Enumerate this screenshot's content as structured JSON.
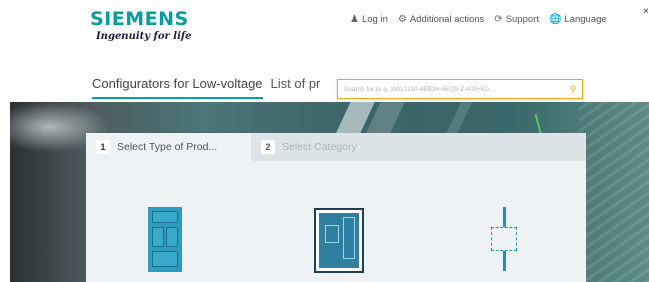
{
  "brand": {
    "name": "SIEMENS",
    "tagline": "Ingenuity for life"
  },
  "header_actions": [
    {
      "label": "Log in",
      "icon": "user-icon"
    },
    {
      "label": "Additional actions",
      "icon": "gear-icon"
    },
    {
      "label": "Support",
      "icon": "support-icon"
    },
    {
      "label": "Language",
      "icon": "globe-icon"
    }
  ],
  "nav": {
    "tabs": [
      "Configurators for Low-voltage",
      "List of pr"
    ]
  },
  "search": {
    "placeholder": "Search for (e.g. 3WL1110-4EB36-6EQ9-Z A05+E0...",
    "icon": "search-icon"
  },
  "wizard": {
    "steps": [
      {
        "number": "1",
        "label": "Select Type of Prod..."
      },
      {
        "number": "2",
        "label": "Select Category"
      }
    ],
    "products": [
      {
        "name": "molded-case-breaker",
        "icon": "breaker-icon"
      },
      {
        "name": "air-circuit-breaker",
        "icon": "acb-icon"
      },
      {
        "name": "switch-disconnector",
        "icon": "disconnector-icon"
      }
    ]
  },
  "colors": {
    "brand": "#0a9c9f",
    "search_border": "#f5a623",
    "product_blue": "#2f9cbe"
  }
}
